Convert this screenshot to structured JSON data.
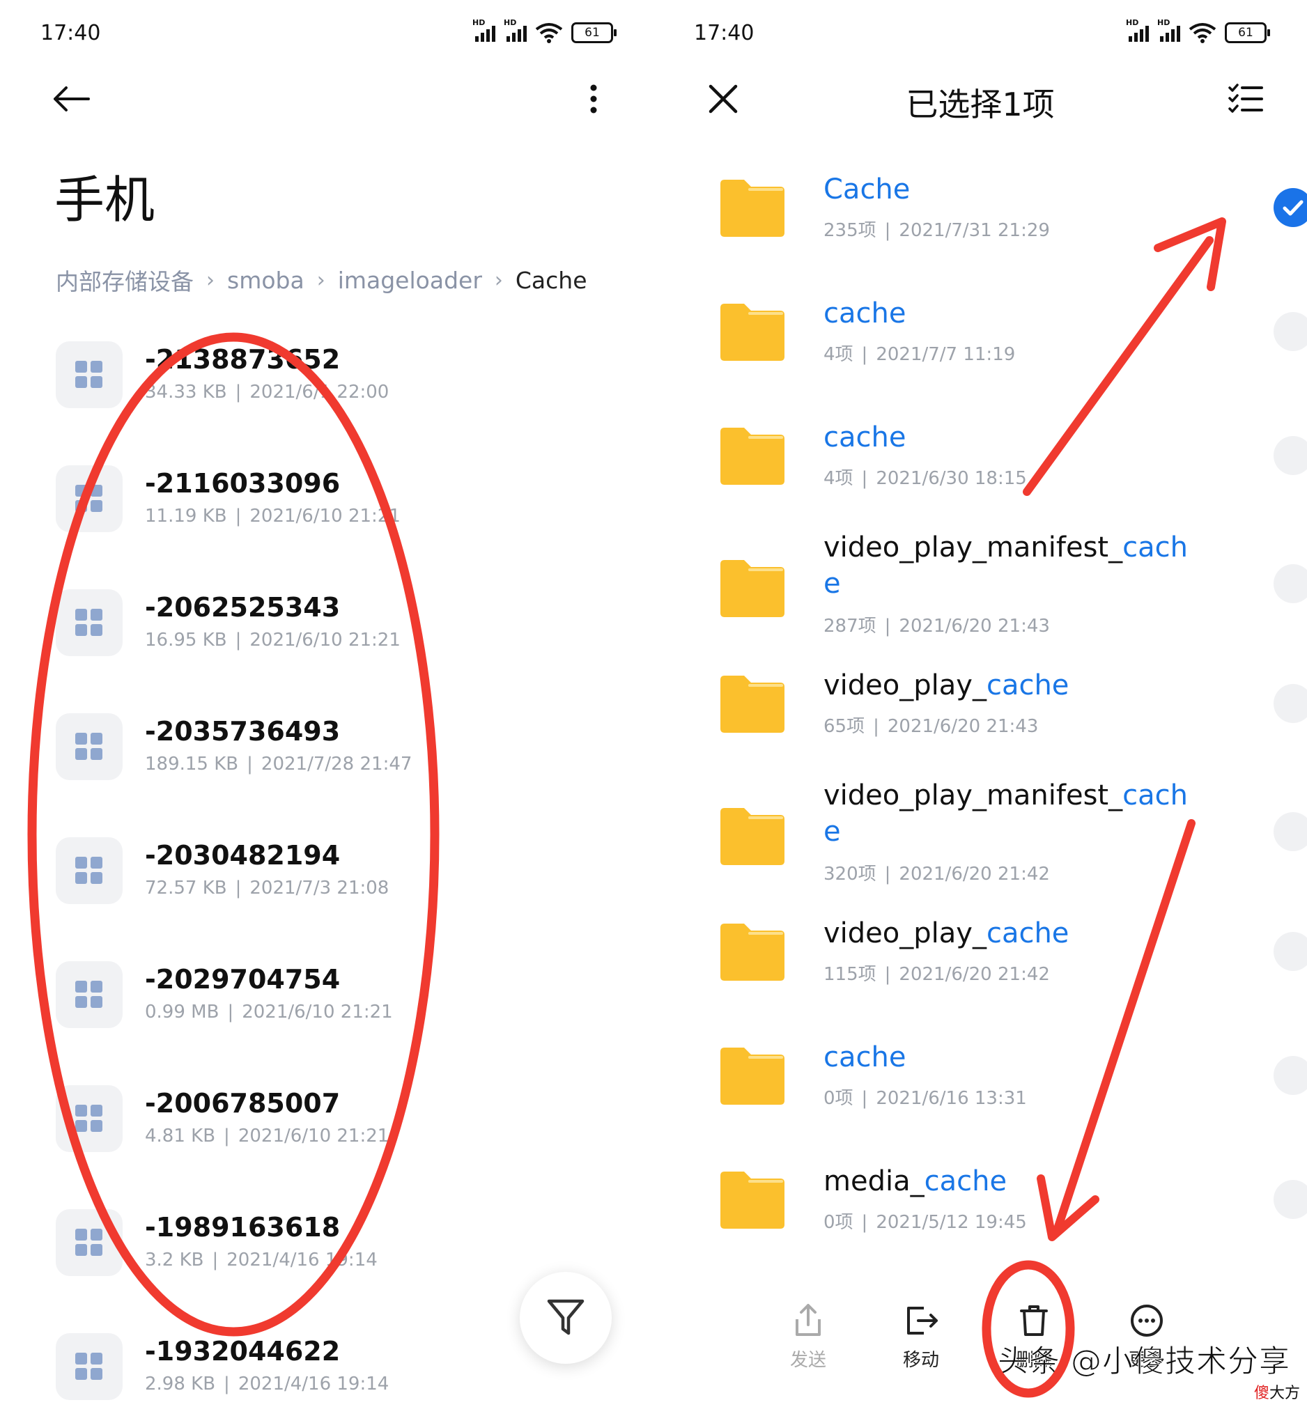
{
  "status_bar": {
    "time": "17:40",
    "signal_tag": "HD",
    "battery": "61"
  },
  "left": {
    "title": "手机",
    "breadcrumb": [
      "内部存储设备",
      "smoba",
      "imageloader",
      "Cache"
    ],
    "files": [
      {
        "name": "-2138873652",
        "size": "34.33 KB",
        "date": "2021/6/1 22:00"
      },
      {
        "name": "-2116033096",
        "size": "11.19 KB",
        "date": "2021/6/10 21:21"
      },
      {
        "name": "-2062525343",
        "size": "16.95 KB",
        "date": "2021/6/10 21:21"
      },
      {
        "name": "-2035736493",
        "size": "189.15 KB",
        "date": "2021/7/28 21:47"
      },
      {
        "name": "-2030482194",
        "size": "72.57 KB",
        "date": "2021/7/3 21:08"
      },
      {
        "name": "-2029704754",
        "size": "0.99 MB",
        "date": "2021/6/10 21:21"
      },
      {
        "name": "-2006785007",
        "size": "4.81 KB",
        "date": "2021/6/10 21:21"
      },
      {
        "name": "-1989163618",
        "size": "3.2 KB",
        "date": "2021/4/16 19:14"
      },
      {
        "name": "-1932044622",
        "size": "2.98 KB",
        "date": "2021/4/16 19:14"
      }
    ]
  },
  "right": {
    "title": "已选择1项",
    "folders": [
      {
        "pre": "",
        "hl": "Cache",
        "post": "",
        "count": "235项",
        "date": "2021/7/31 21:29",
        "selected": true
      },
      {
        "pre": "",
        "hl": "cache",
        "post": "",
        "count": "4项",
        "date": "2021/7/7 11:19",
        "selected": false
      },
      {
        "pre": "",
        "hl": "cache",
        "post": "",
        "count": "4项",
        "date": "2021/6/30 18:15",
        "selected": false
      },
      {
        "pre": "video_play_manifest_",
        "hl": "cach e",
        "post": "",
        "count": "287项",
        "date": "2021/6/20 21:43",
        "selected": false
      },
      {
        "pre": "video_play_",
        "hl": "cache",
        "post": "",
        "count": "65项",
        "date": "2021/6/20 21:43",
        "selected": false
      },
      {
        "pre": "video_play_manifest_",
        "hl": "cach e",
        "post": "",
        "count": "320项",
        "date": "2021/6/20 21:42",
        "selected": false
      },
      {
        "pre": "video_play_",
        "hl": "cache",
        "post": "",
        "count": "115项",
        "date": "2021/6/20 21:42",
        "selected": false
      },
      {
        "pre": "",
        "hl": "cache",
        "post": "",
        "count": "0项",
        "date": "2021/6/16 13:31",
        "selected": false
      },
      {
        "pre": "media_",
        "hl": "cache",
        "post": "",
        "count": "0项",
        "date": "2021/5/12 19:45",
        "selected": false
      }
    ],
    "actions": [
      {
        "label": "发送",
        "icon": "share-icon",
        "disabled": true
      },
      {
        "label": "移动",
        "icon": "move-icon",
        "disabled": false
      },
      {
        "label": "删除",
        "icon": "trash-icon",
        "disabled": false
      },
      {
        "label": "更多",
        "icon": "more-icon",
        "disabled": false
      }
    ]
  },
  "watermark": {
    "main": "头条 @小傻技术分享",
    "sub_red": "傻",
    "sub_rest": "大方"
  },
  "colors": {
    "accent": "#1a73e8",
    "folder": "#fbc02d",
    "annotation": "#f03a2f"
  }
}
